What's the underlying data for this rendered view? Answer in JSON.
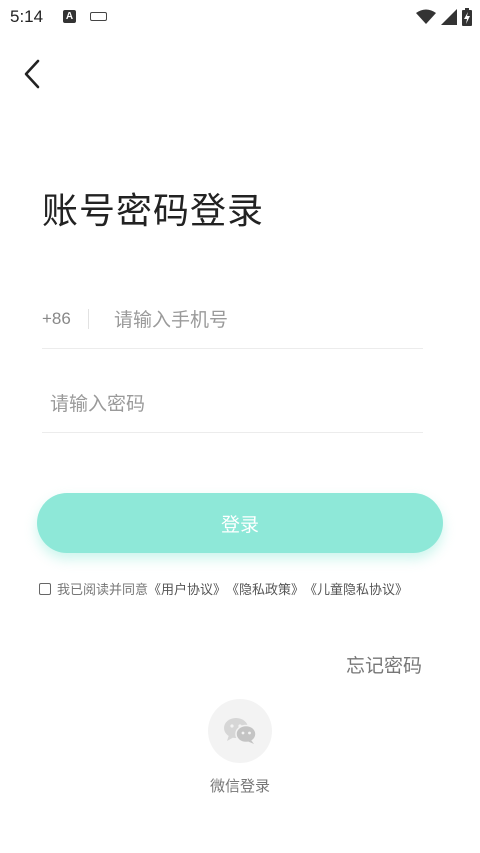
{
  "status_bar": {
    "time": "5:14",
    "a_label": "A"
  },
  "header": {
    "back_icon": "chevron-left-icon"
  },
  "title": "账号密码登录",
  "phone": {
    "country_code": "+86",
    "value": "",
    "placeholder": "请输入手机号"
  },
  "password": {
    "value": "",
    "placeholder": "请输入密码"
  },
  "login_button": {
    "label": "登录",
    "color": "#8ee8d8"
  },
  "agreement": {
    "prefix": "我已阅读并同意",
    "user_agreement": "《用户协议》",
    "privacy_policy": "《隐私政策》",
    "child_privacy": "《儿童隐私协议》",
    "checked": false
  },
  "forgot_password": "忘记密码",
  "wechat_login": {
    "label": "微信登录",
    "icon": "wechat-icon"
  }
}
